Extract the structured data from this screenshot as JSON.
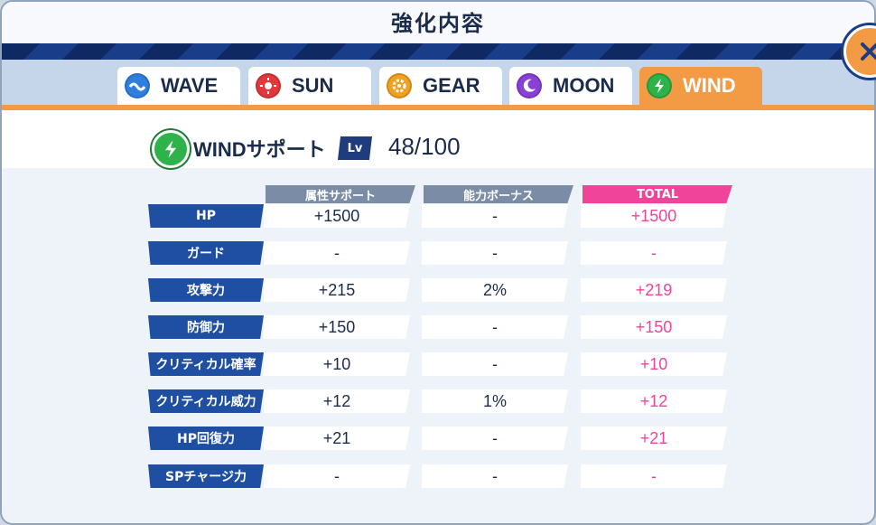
{
  "dialog": {
    "title": "強化内容",
    "close_icon": "close-icon"
  },
  "tabs": [
    {
      "label": "WAVE",
      "icon": "wave-icon",
      "color": "#2f7fe0",
      "active": false
    },
    {
      "label": "SUN",
      "icon": "sun-icon",
      "color": "#e2383c",
      "active": false
    },
    {
      "label": "GEAR",
      "icon": "gear-icon",
      "color": "#f2a01f",
      "active": false
    },
    {
      "label": "MOON",
      "icon": "moon-icon",
      "color": "#8a3fd6",
      "active": false
    },
    {
      "label": "WIND",
      "icon": "wind-icon",
      "color": "#2eb24a",
      "active": true
    }
  ],
  "support": {
    "name": "WINDサポート",
    "lv_label": "Lv",
    "level": "48/100",
    "icon": "wind-icon"
  },
  "columns": [
    {
      "label": "属性サポート",
      "color": "#7b8da6"
    },
    {
      "label": "能力ボーナス",
      "color": "#7b8da6"
    },
    {
      "label": "TOTAL",
      "color": "#f0449b"
    }
  ],
  "rows": [
    {
      "label": "HP",
      "support": "+1500",
      "bonus": "-",
      "total": "+1500"
    },
    {
      "label": "ガード",
      "support": "-",
      "bonus": "-",
      "total": "-"
    },
    {
      "label": "攻撃力",
      "support": "+215",
      "bonus": "2%",
      "total": "+219"
    },
    {
      "label": "防御力",
      "support": "+150",
      "bonus": "-",
      "total": "+150"
    },
    {
      "label": "クリティカル確率",
      "support": "+10",
      "bonus": "-",
      "total": "+10"
    },
    {
      "label": "クリティカル威力",
      "support": "+12",
      "bonus": "1%",
      "total": "+12"
    },
    {
      "label": "HP回復力",
      "support": "+21",
      "bonus": "-",
      "total": "+21"
    },
    {
      "label": "SPチャージ力",
      "support": "-",
      "bonus": "-",
      "total": "-"
    }
  ],
  "colors": {
    "accent": "#f39a45",
    "header_navy": "#0f2a63",
    "row_label": "#1f4fa3",
    "total_pink": "#f0449b"
  }
}
